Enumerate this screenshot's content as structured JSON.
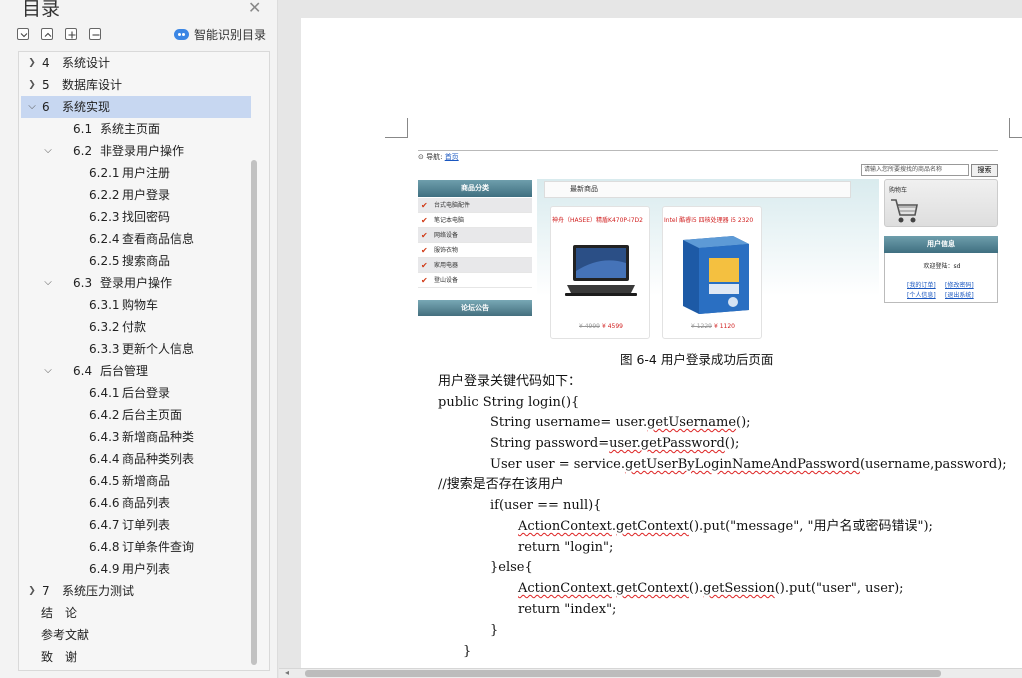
{
  "toc": {
    "title": "目录",
    "close_icon": "close-icon",
    "toolbar": [
      "collapse-all-icon",
      "expand-up-icon",
      "expand-all-icon",
      "collapse-minus-icon"
    ],
    "smart_label": "智能识别目录",
    "items": [
      {
        "num": "4",
        "text": "系统设计",
        "level": 1,
        "arrow": "›"
      },
      {
        "num": "5",
        "text": "数据库设计",
        "level": 1,
        "arrow": "›"
      },
      {
        "num": "6",
        "text": "系统实现",
        "level": 1,
        "arrow": "⌄",
        "selected": true
      },
      {
        "num": "6.1",
        "text": "系统主页面",
        "level": 2,
        "arrow": ""
      },
      {
        "num": "6.2",
        "text": "非登录用户操作",
        "level": 2,
        "arrow": "⌄"
      },
      {
        "num": "6.2.1",
        "text": "用户注册",
        "level": 3,
        "arrow": ""
      },
      {
        "num": "6.2.2",
        "text": "用户登录",
        "level": 3,
        "arrow": ""
      },
      {
        "num": "6.2.3",
        "text": "找回密码",
        "level": 3,
        "arrow": ""
      },
      {
        "num": "6.2.4",
        "text": "查看商品信息",
        "level": 3,
        "arrow": ""
      },
      {
        "num": "6.2.5",
        "text": "搜索商品",
        "level": 3,
        "arrow": ""
      },
      {
        "num": "6.3",
        "text": "登录用户操作",
        "level": 2,
        "arrow": "⌄"
      },
      {
        "num": "6.3.1",
        "text": "购物车",
        "level": 3,
        "arrow": ""
      },
      {
        "num": "6.3.2",
        "text": "付款",
        "level": 3,
        "arrow": ""
      },
      {
        "num": "6.3.3",
        "text": "更新个人信息",
        "level": 3,
        "arrow": ""
      },
      {
        "num": "6.4",
        "text": "后台管理",
        "level": 2,
        "arrow": "⌄"
      },
      {
        "num": "6.4.1",
        "text": "后台登录",
        "level": 3,
        "arrow": ""
      },
      {
        "num": "6.4.2",
        "text": "后台主页面",
        "level": 3,
        "arrow": ""
      },
      {
        "num": "6.4.3",
        "text": "新增商品种类",
        "level": 3,
        "arrow": ""
      },
      {
        "num": "6.4.4",
        "text": "商品种类列表",
        "level": 3,
        "arrow": ""
      },
      {
        "num": "6.4.5",
        "text": "新增商品",
        "level": 3,
        "arrow": ""
      },
      {
        "num": "6.4.6",
        "text": "商品列表",
        "level": 3,
        "arrow": ""
      },
      {
        "num": "6.4.7",
        "text": "订单列表",
        "level": 3,
        "arrow": ""
      },
      {
        "num": "6.4.8",
        "text": "订单条件查询",
        "level": 3,
        "arrow": ""
      },
      {
        "num": "6.4.9",
        "text": "用户列表",
        "level": 3,
        "arrow": ""
      },
      {
        "num": "7",
        "text": "系统压力测试",
        "level": 1,
        "arrow": "›"
      },
      {
        "num": "",
        "text": "结　论",
        "level": 1,
        "arrow": ""
      },
      {
        "num": "",
        "text": "参考文献",
        "level": 1,
        "arrow": ""
      },
      {
        "num": "",
        "text": "致　谢",
        "level": 1,
        "arrow": ""
      }
    ]
  },
  "figure": {
    "nav_prefix": "导航:",
    "nav_link": "首页",
    "search_placeholder": "请输入您所要搜找的商品名称",
    "search_button": "搜索",
    "category_title": "商品分类",
    "categories": [
      "台式电脑配件",
      "笔记本电脑",
      "网络设备",
      "服饰衣物",
      "家用电器",
      "登山设备"
    ],
    "notice_title": "论坛公告",
    "new_products_title": "最新商品",
    "products": [
      {
        "name": "神舟（HASEE）精盾K470P-i7D2",
        "old_price": "¥ 4999",
        "price": "¥ 4599"
      },
      {
        "name": "Intel 酷睿i5 四核处理器 i5 2320",
        "old_price": "¥ 1229",
        "price": "¥ 1120"
      }
    ],
    "cart_title": "购物车",
    "user_info_title": "用户信息",
    "welcome": "欢迎登陆：sd",
    "user_links": [
      "[我的订单]",
      "[修改密码]",
      "[个人信息]",
      "[退出系统]"
    ]
  },
  "caption": "图 6-4  用户登录成功后页面",
  "code_lines": [
    "用户登录关键代码如下：",
    "public String login(){",
    "String username= user.getUsername();",
    "String password=user.getPassword();",
    "User user = service.getUserByLoginNameAndPassword(username,password);",
    "//搜索是否存在该用户",
    "if(user == null){",
    "ActionContext.getContext().put(\"message\", \"用户名或密码错误\");",
    "return \"login\";",
    "}else{",
    "ActionContext.getContext().getSession().put(\"user\", user);",
    "return \"index\";",
    "}",
    "}"
  ],
  "colors": {
    "selection": "#c7d7f1",
    "accent_blue": "#3b86e4",
    "price_red": "#d12020",
    "panel_teal": "#4f7f8f"
  }
}
